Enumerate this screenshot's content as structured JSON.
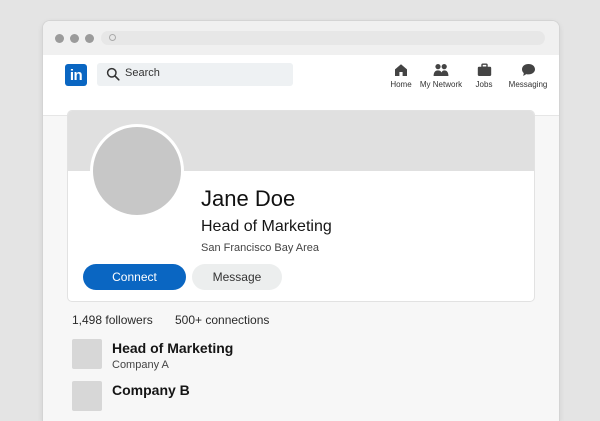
{
  "nav": {
    "logo_text": "in",
    "search_placeholder": "Search",
    "items": [
      {
        "label": "Home",
        "icon": "home-icon"
      },
      {
        "label": "My Network",
        "icon": "network-icon"
      },
      {
        "label": "Jobs",
        "icon": "briefcase-icon"
      },
      {
        "label": "Messaging",
        "icon": "messaging-icon"
      }
    ]
  },
  "profile": {
    "name": "Jane Doe",
    "headline": "Head of Marketing",
    "location": "San Francisco Bay Area",
    "connect_label": "Connect",
    "message_label": "Message"
  },
  "stats": {
    "followers": "1,498 followers",
    "connections": "500+ connections"
  },
  "experience": [
    {
      "title": "Head of Marketing",
      "company": "Company A"
    },
    {
      "title": "Company B",
      "company": ""
    }
  ],
  "colors": {
    "brand": "#0a66c2",
    "background": "#f7f7f7"
  }
}
